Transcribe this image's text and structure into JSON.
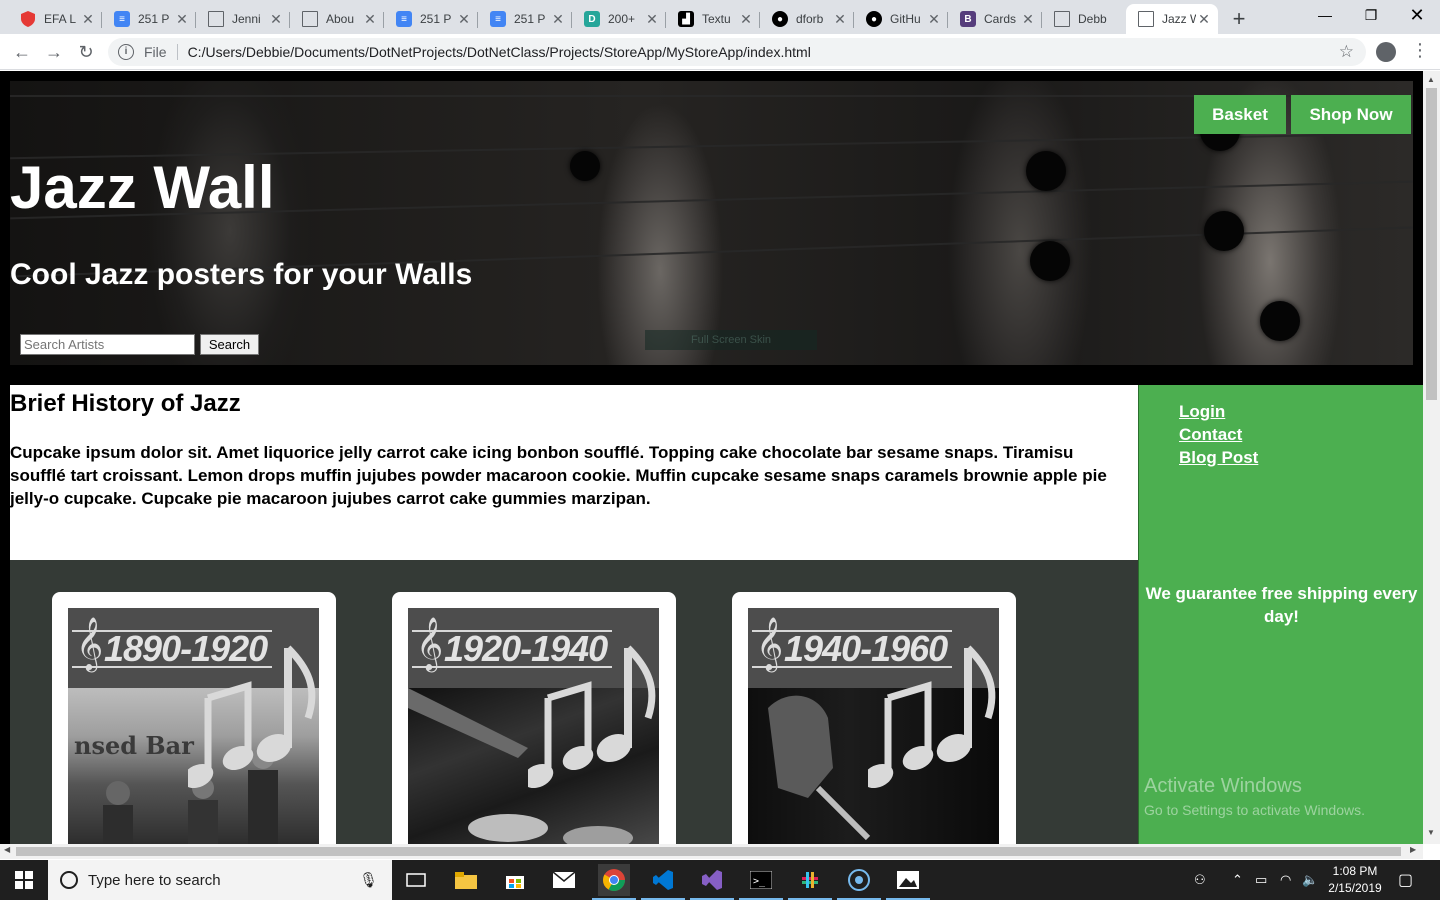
{
  "browser": {
    "tabs": [
      {
        "title": "EFA L",
        "icon": "shield-icon",
        "color": "#e53935"
      },
      {
        "title": "251 P",
        "icon": "docs-icon",
        "color": "#4285f4"
      },
      {
        "title": "Jenni",
        "icon": "page-icon",
        "color": "#5f6368"
      },
      {
        "title": "Abou",
        "icon": "page-icon",
        "color": "#5f6368"
      },
      {
        "title": "251 P",
        "icon": "docs-icon",
        "color": "#4285f4"
      },
      {
        "title": "251 P",
        "icon": "docs-icon",
        "color": "#4285f4"
      },
      {
        "title": "200+",
        "icon": "d-icon",
        "color": "#26a69a"
      },
      {
        "title": "Textu",
        "icon": "textures-icon",
        "color": "#000000"
      },
      {
        "title": "dforb",
        "icon": "github-icon",
        "color": "#000000"
      },
      {
        "title": "GitHu",
        "icon": "github-icon",
        "color": "#000000"
      },
      {
        "title": "Cards",
        "icon": "bootstrap-icon",
        "color": "#563d7c"
      },
      {
        "title": "Debb",
        "icon": "page-icon",
        "color": "#5f6368"
      },
      {
        "title": "Jazz W",
        "icon": "page-icon",
        "color": "#5f6368"
      }
    ],
    "address_prefix": "File",
    "url": "C:/Users/Debbie/Documents/DotNetProjects/DotNetClass/Projects/StoreApp/MyStoreApp/index.html"
  },
  "page": {
    "stray_text": "-->",
    "header": {
      "title": "Jazz Wall",
      "subtitle": "Cool Jazz posters for your Walls",
      "search_placeholder": "Search Artists",
      "search_button": "Search",
      "ghost_button": "Full Screen Skin",
      "basket_button": "Basket",
      "shop_button": "Shop Now"
    },
    "history": {
      "heading": "Brief History of Jazz",
      "body": "Cupcake ipsum dolor sit. Amet liquorice jelly carrot cake icing bonbon soufflé. Topping cake chocolate bar sesame snaps. Tiramisu soufflé tart croissant. Lemon drops muffin jujubes powder macaroon cookie. Muffin cupcake sesame snaps caramels brownie apple pie jelly-o cupcake. Cupcake pie macaroon jujubes carrot cake gummies marzipan."
    },
    "sidebar": {
      "links": [
        "Login",
        "Contact",
        "Blog Post"
      ],
      "promo": "We guarantee free shipping every day!"
    },
    "posters": [
      {
        "years": "1890-1920"
      },
      {
        "years": "1920-1940"
      },
      {
        "years": "1940-1960"
      }
    ],
    "watermark": {
      "line1": "Activate Windows",
      "line2": "Go to Settings to activate Windows."
    }
  },
  "taskbar": {
    "search_placeholder": "Type here to search",
    "time": "1:08 PM",
    "date": "2/15/2019"
  },
  "colors": {
    "accent_green": "#4caf50",
    "gallery_bg": "#343a36",
    "chrome_tab_bar": "#dee1e6"
  }
}
